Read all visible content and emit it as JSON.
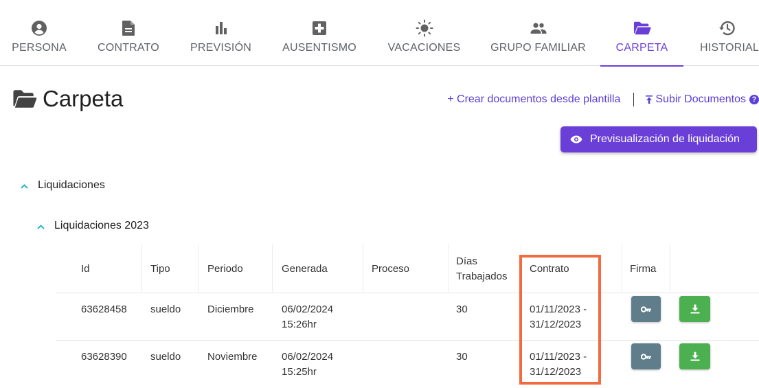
{
  "tabs": [
    {
      "label": "PERSONA",
      "icon": "account-circle-icon"
    },
    {
      "label": "CONTRATO",
      "icon": "document-icon"
    },
    {
      "label": "PREVISIÓN",
      "icon": "bar-chart-icon"
    },
    {
      "label": "AUSENTISMO",
      "icon": "medical-plus-icon"
    },
    {
      "label": "VACACIONES",
      "icon": "sun-icon"
    },
    {
      "label": "GRUPO FAMILIAR",
      "icon": "people-icon"
    },
    {
      "label": "CARPETA",
      "icon": "folder-open-icon",
      "active": true
    },
    {
      "label": "HISTORIAL",
      "icon": "history-icon"
    }
  ],
  "page": {
    "title": "Carpeta",
    "create_link": "+ Crear documentos desde plantilla",
    "upload_link": "Subir Documentos",
    "help_glyph": "?",
    "preview_button": "Previsualización de liquidación"
  },
  "sections": {
    "main": "Liquidaciones",
    "sub": "Liquidaciones 2023"
  },
  "table": {
    "headers": {
      "id": "Id",
      "tipo": "Tipo",
      "periodo": "Periodo",
      "generada": "Generada",
      "proceso": "Proceso",
      "dias_1": "Días",
      "dias_2": "Trabajados",
      "contrato": "Contrato",
      "firma": "Firma"
    },
    "rows": [
      {
        "id": "63628458",
        "tipo": "sueldo",
        "periodo": "Diciembre",
        "generada_1": "06/02/2024",
        "generada_2": "15:26hr",
        "proceso": "",
        "dias": "30",
        "contrato_1": "01/11/2023 -",
        "contrato_2": "31/12/2023"
      },
      {
        "id": "63628390",
        "tipo": "sueldo",
        "periodo": "Noviembre",
        "generada_1": "06/02/2024",
        "generada_2": "15:25hr",
        "proceso": "",
        "dias": "30",
        "contrato_1": "01/11/2023 -",
        "contrato_2": "31/12/2023"
      }
    ]
  },
  "colors": {
    "accent": "#6a3fd8",
    "link": "#5b3fd6",
    "chevron": "#29b6c8",
    "key_button": "#607d8b",
    "download_button": "#4caf50",
    "highlight": "#f26a3d"
  }
}
